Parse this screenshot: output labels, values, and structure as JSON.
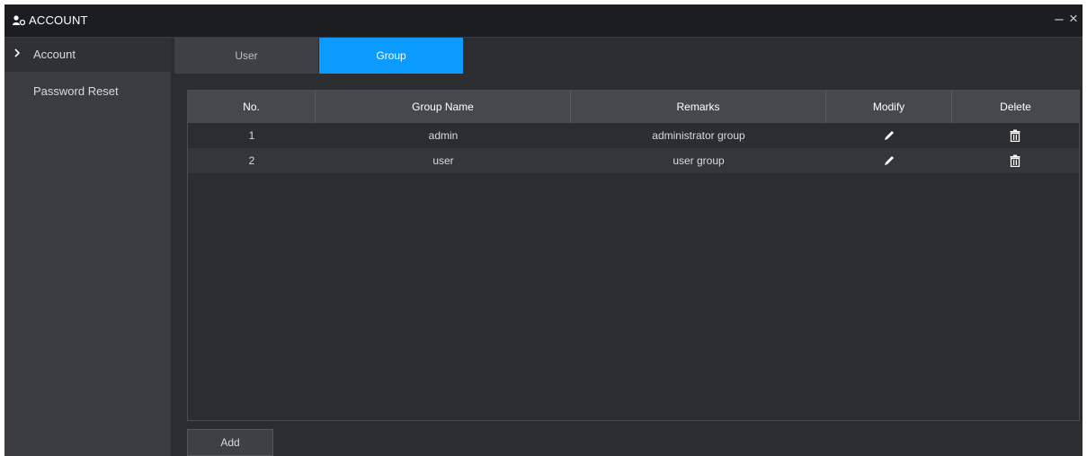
{
  "window": {
    "title": "ACCOUNT",
    "minimize_label": "–",
    "close_label": "×"
  },
  "sidebar": {
    "items": [
      {
        "label": "Account",
        "active": true
      },
      {
        "label": "Password Reset",
        "active": false
      }
    ]
  },
  "tabs": [
    {
      "label": "User",
      "active": false
    },
    {
      "label": "Group",
      "active": true
    }
  ],
  "table": {
    "columns": [
      "No.",
      "Group Name",
      "Remarks",
      "Modify",
      "Delete"
    ],
    "rows": [
      {
        "no": "1",
        "group_name": "admin",
        "remarks": "administrator group"
      },
      {
        "no": "2",
        "group_name": "user",
        "remarks": "user group"
      }
    ]
  },
  "add_button": {
    "label": "Add"
  },
  "colors": {
    "accent": "#0b9bff",
    "background": "#2b2d31",
    "titlebar": "#1c1d20",
    "sidebar": "#3a3c41",
    "table_header": "#46484d"
  },
  "icons": {
    "title": "account-icon",
    "modify": "pencil-icon",
    "delete": "trash-icon",
    "sidebar_active": "chevron-right-icon"
  }
}
